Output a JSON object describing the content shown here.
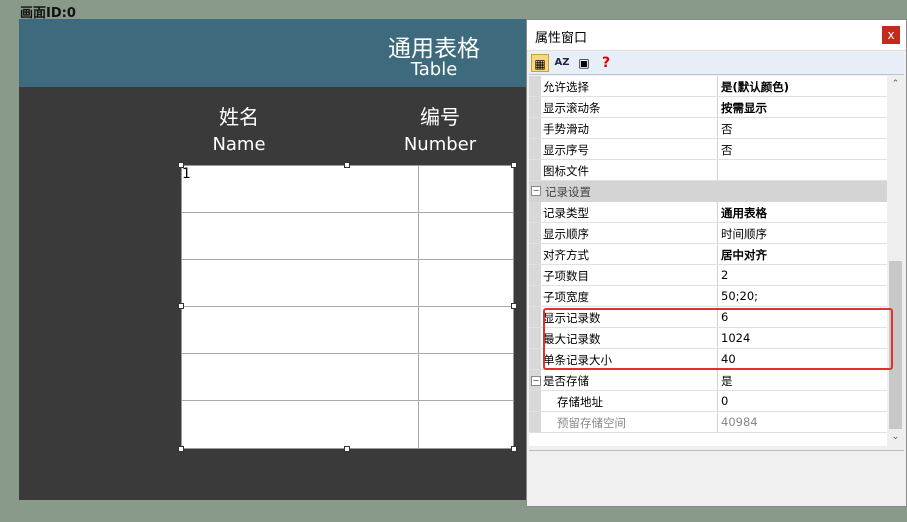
{
  "canvas": {
    "id_label": "画面ID:0"
  },
  "screen": {
    "header_cn": "通用表格",
    "header_en": "Table",
    "columns": [
      {
        "cn": "姓名",
        "en": "Name"
      },
      {
        "cn": "编号",
        "en": "Number"
      }
    ],
    "first_seq": "1"
  },
  "props_window": {
    "title": "属性窗口",
    "close": "x",
    "toolbar": [
      "categorized",
      "alphabetical",
      "property-pages",
      "help"
    ],
    "rows": [
      {
        "name": "允许选择",
        "value": "是(默认颜色)",
        "bold": true
      },
      {
        "name": "显示滚动条",
        "value": "按需显示",
        "bold": true
      },
      {
        "name": "手势滑动",
        "value": "否"
      },
      {
        "name": "显示序号",
        "value": "否"
      },
      {
        "name": "图标文件",
        "value": ""
      }
    ],
    "category": "记录设置",
    "rows2": [
      {
        "name": "记录类型",
        "value": "通用表格",
        "bold": true
      },
      {
        "name": "显示顺序",
        "value": "时间顺序"
      },
      {
        "name": "对齐方式",
        "value": "居中对齐",
        "bold": true
      },
      {
        "name": "子项数目",
        "value": "2"
      },
      {
        "name": "子项宽度",
        "value": "50;20;"
      },
      {
        "name": "显示记录数",
        "value": "6"
      },
      {
        "name": "最大记录数",
        "value": "1024"
      },
      {
        "name": "单条记录大小",
        "value": "40"
      },
      {
        "name": "是否存储",
        "value": "是"
      },
      {
        "name": "存储地址",
        "value": "0"
      },
      {
        "name": "预留存储空间",
        "value": "40984"
      }
    ]
  },
  "colors": {
    "header": "#3d6a7c",
    "screen_bg": "#3a3a3a",
    "highlight": "#e03030"
  }
}
